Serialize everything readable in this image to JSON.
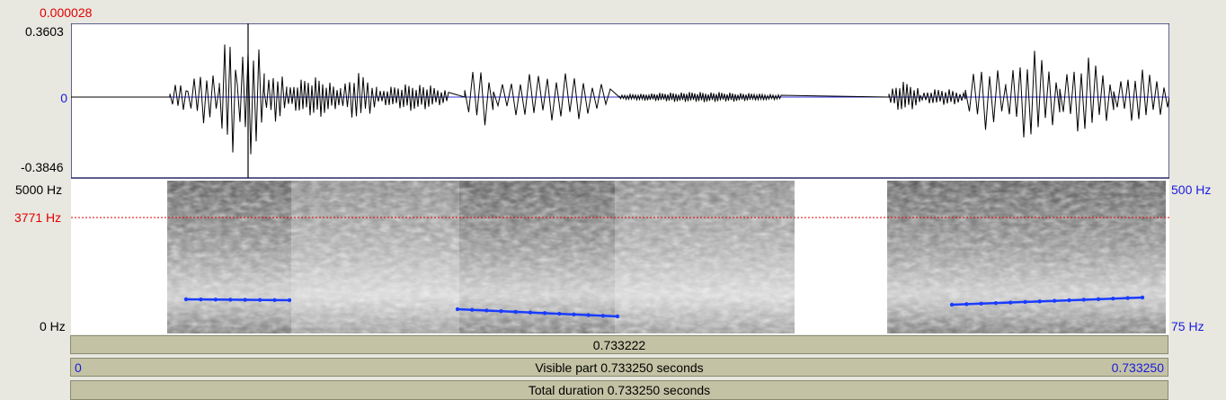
{
  "cursor": {
    "time": "0.000028"
  },
  "waveform": {
    "max_label": "0.3603",
    "zero_label": "0",
    "min_label": "-0.3846"
  },
  "spectrogram": {
    "max_label": "5000 Hz",
    "cursor_freq_label": "3771 Hz",
    "min_label": "0 Hz"
  },
  "pitch": {
    "max_label": "500 Hz",
    "min_label": "75 Hz"
  },
  "bars": {
    "selection_value": "0.733222",
    "visible_start": "0",
    "visible_label": "Visible part 0.733250 seconds",
    "visible_end": "0.733250",
    "total_label": "Total duration 0.733250 seconds"
  },
  "colors": {
    "cursor_red": "#e00000",
    "axis_blue": "#1a1ae0",
    "pitch_line": "#1a3cff",
    "bar_fill": "#c3c2a4"
  }
}
